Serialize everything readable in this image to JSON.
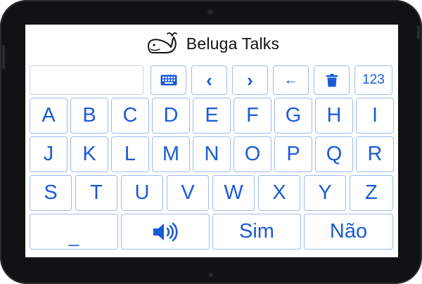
{
  "app": {
    "title": "Beluga Talks"
  },
  "input": {
    "value": ""
  },
  "toolbar": {
    "keyboard_icon": "keyboard-icon",
    "prev_label": "‹",
    "next_label": "›",
    "back_label": "←",
    "delete_icon": "trash-icon",
    "numbers_label": "123"
  },
  "keyboard": {
    "rows": [
      [
        "A",
        "B",
        "C",
        "D",
        "E",
        "F",
        "G",
        "H",
        "I"
      ],
      [
        "J",
        "K",
        "L",
        "M",
        "N",
        "O",
        "P",
        "Q",
        "R"
      ],
      [
        "S",
        "T",
        "U",
        "V",
        "W",
        "X",
        "Y",
        "Z"
      ]
    ]
  },
  "bottom": {
    "space_label": "_",
    "speak_icon": "speaker-icon",
    "yes_label": "Sim",
    "no_label": "Não"
  },
  "colors": {
    "accent": "#1a5bd6",
    "key_border": "#9dbcec",
    "bezel": "#111214"
  }
}
